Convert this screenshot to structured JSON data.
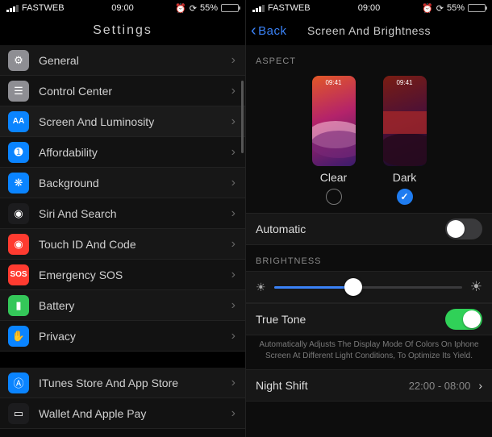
{
  "statusbar": {
    "carrier": "FASTWEB",
    "time": "09:00",
    "battery_pct": "55%",
    "battery_fill": 55
  },
  "left": {
    "title": "Settings",
    "rows": [
      {
        "icon": "gear",
        "color": "#8e8e93",
        "label": "General"
      },
      {
        "icon": "cc",
        "color": "#8e8e93",
        "label": "Control Center"
      },
      {
        "icon": "AA",
        "color": "#0a84ff",
        "label": "Screen And Luminosity",
        "selected": true
      },
      {
        "icon": "access",
        "color": "#0a84ff",
        "label": "Affordability"
      },
      {
        "icon": "atom",
        "color": "#0a84ff",
        "label": "Background"
      },
      {
        "icon": "siri",
        "color": "#1c1c1e",
        "label": "Siri And Search"
      },
      {
        "icon": "touch",
        "color": "#ff3b30",
        "label": "Touch ID And Code"
      },
      {
        "icon": "SOS",
        "color": "#ff3b30",
        "label": "Emergency SOS"
      },
      {
        "icon": "batt",
        "color": "#34c759",
        "label": "Battery"
      },
      {
        "icon": "hand",
        "color": "#0a84ff",
        "label": "Privacy"
      }
    ],
    "rows2": [
      {
        "icon": "astore",
        "color": "#0a84ff",
        "label": "ITunes Store And App Store"
      },
      {
        "icon": "wallet",
        "color": "#1c1c1e",
        "label": "Wallet And Apple Pay"
      }
    ]
  },
  "right": {
    "back_label": "Back",
    "title": "Screen And Brightness",
    "aspect_header": "ASPECT",
    "thumb_time": "09:41",
    "clear_label": "Clear",
    "dark_label": "Dark",
    "dark_selected": true,
    "automatic_label": "Automatic",
    "automatic_on": false,
    "brightness_header": "BRIGHTNESS",
    "brightness_pct": 42,
    "truetone_label": "True Tone",
    "truetone_on": true,
    "truetone_note": "Automatically Adjusts The Display Mode Of Colors On Iphone Screen At Different Light Conditions, To Optimize Its Yield.",
    "nightshift_label": "Night Shift",
    "nightshift_detail": "22:00 - 08:00"
  }
}
